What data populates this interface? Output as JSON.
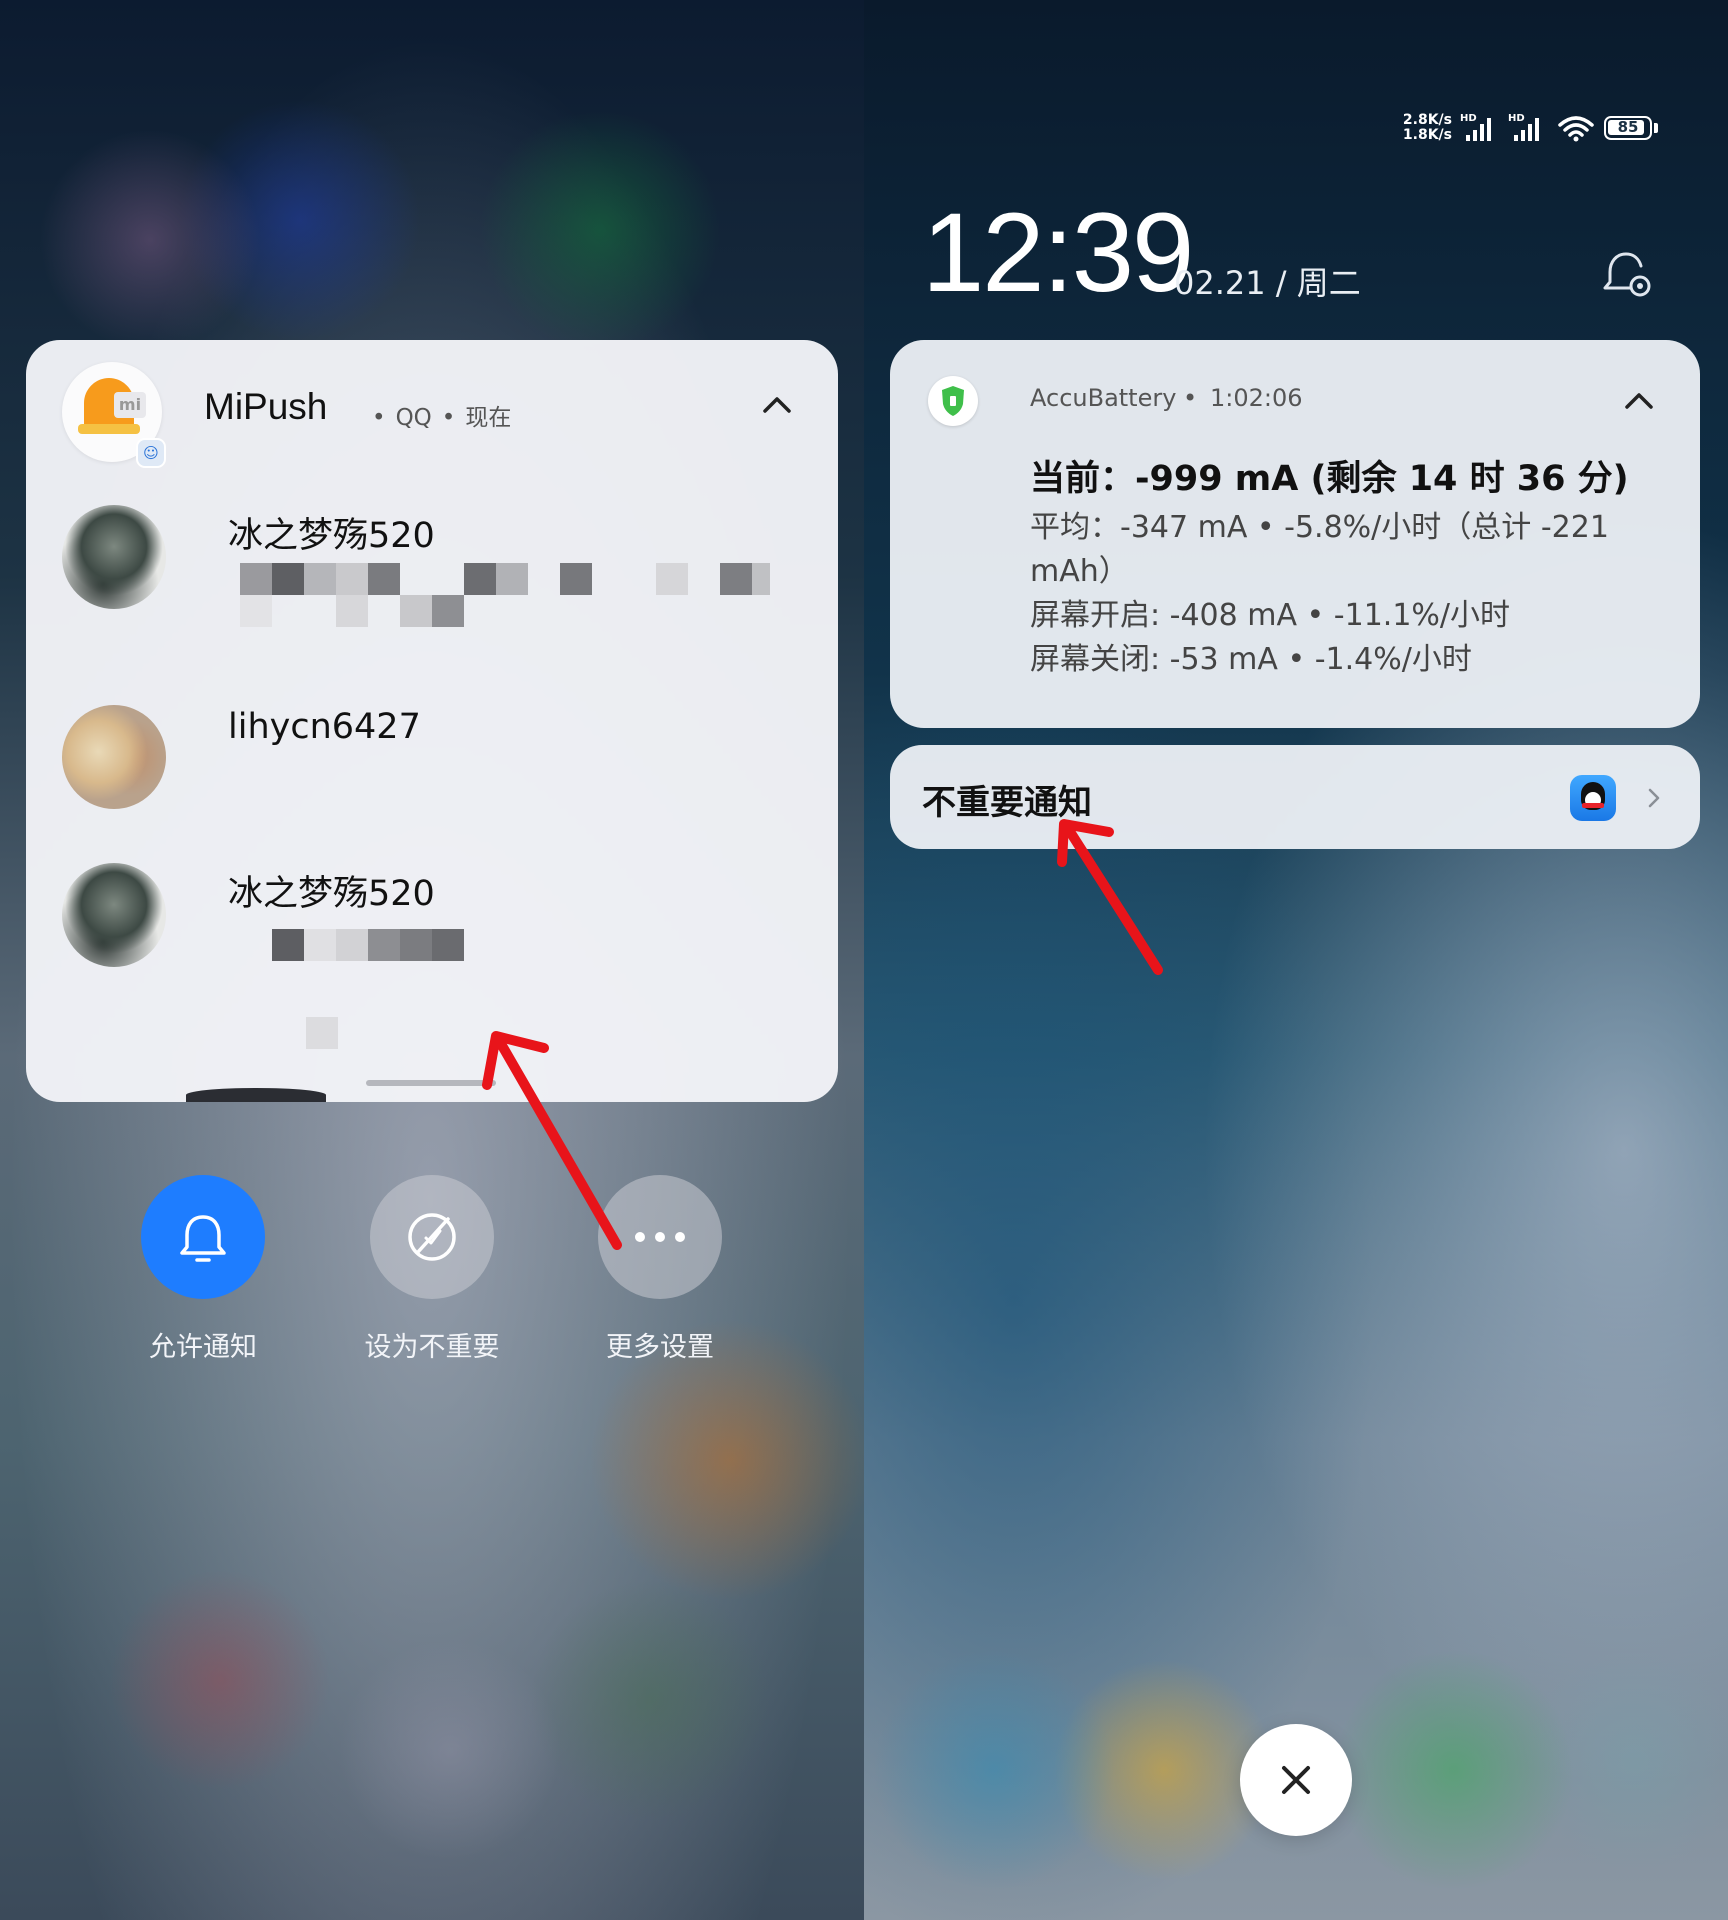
{
  "left": {
    "notification": {
      "app_name": "MiPush",
      "source": "QQ",
      "time": "现在",
      "messages": [
        {
          "sender": "冰之梦殇520"
        },
        {
          "sender": "lihycn6427"
        },
        {
          "sender": "冰之梦殇520"
        }
      ]
    },
    "actions": [
      {
        "label": "允许通知",
        "icon": "bell-icon",
        "active": true
      },
      {
        "label": "设为不重要",
        "icon": "slashed-circle-icon",
        "active": false
      },
      {
        "label": "更多设置",
        "icon": "more-icon",
        "active": false
      }
    ]
  },
  "right": {
    "status_bar": {
      "net_up": "2.8K/s",
      "net_down": "1.8K/s",
      "hd1": "HD",
      "hd2": "HD",
      "battery": "85"
    },
    "clock": "12:39",
    "date": "02.21 / 周二",
    "battery_notification": {
      "app_name": "AccuBattery",
      "time": "1:02:06",
      "title": "当前：-999 mA (剩余 14 时 36 分)",
      "lines": [
        "平均：-347 mA • -5.8%/小时（总计 -221 mAh）",
        "屏幕开启: -408 mA • -11.1%/小时",
        "屏幕关闭: -53 mA • -1.4%/小时"
      ]
    },
    "unimportant": {
      "label": "不重要通知"
    }
  },
  "colors": {
    "accent_blue": "#1e7dff",
    "arrow_red": "#e8141a",
    "card_bg": "#f2f3f7"
  }
}
